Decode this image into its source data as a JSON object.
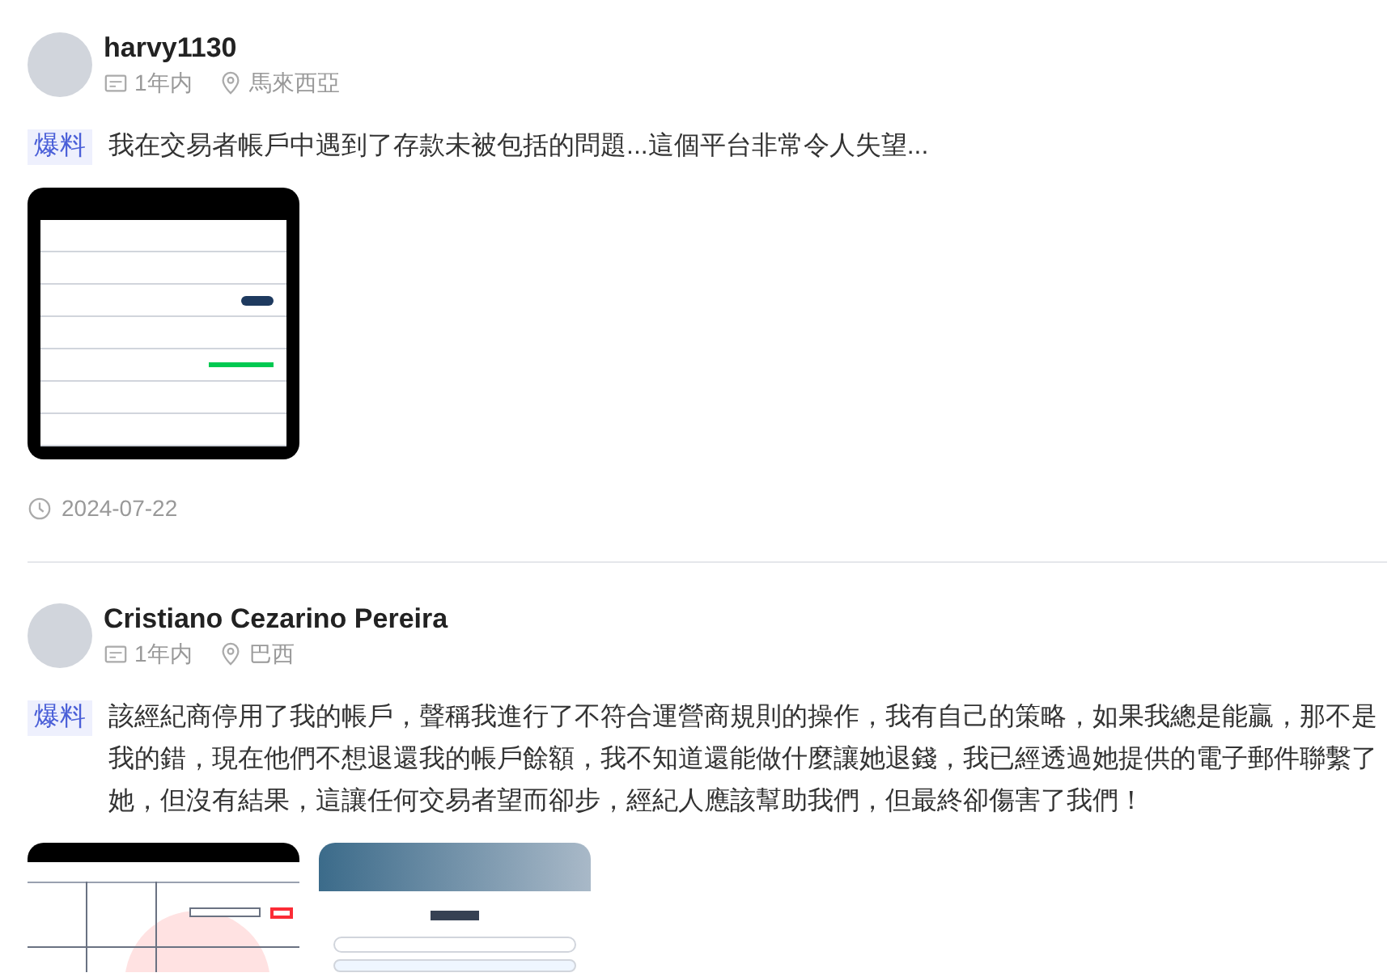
{
  "posts": [
    {
      "author": "harvy1130",
      "time": "1年内",
      "location": "馬來西亞",
      "tag": "爆料",
      "body": "我在交易者帳戶中遇到了存款未被包括的問題...這個平台非常令人失望...",
      "images": [
        {
          "kind": "dark-screenshot"
        }
      ],
      "date": "2024-07-22"
    },
    {
      "author": "Cristiano Cezarino Pereira",
      "time": "1年内",
      "location": "巴西",
      "tag": "爆料",
      "body": "該經紀商停用了我的帳戶，聲稱我進行了不符合運營商規則的操作，我有自己的策略，如果我總是能贏，那不是我的錯，現在他們不想退還我的帳戶餘額，我不知道還能做什麼讓她退錢，我已經透過她提供的電子郵件聯繫了她，但沒有結果，這讓任何交易者望而卻步，經紀人應該幫助我們，但最終卻傷害了我們！",
      "images": [
        {
          "kind": "chart-screenshot"
        },
        {
          "kind": "login-screenshot"
        }
      ]
    }
  ]
}
